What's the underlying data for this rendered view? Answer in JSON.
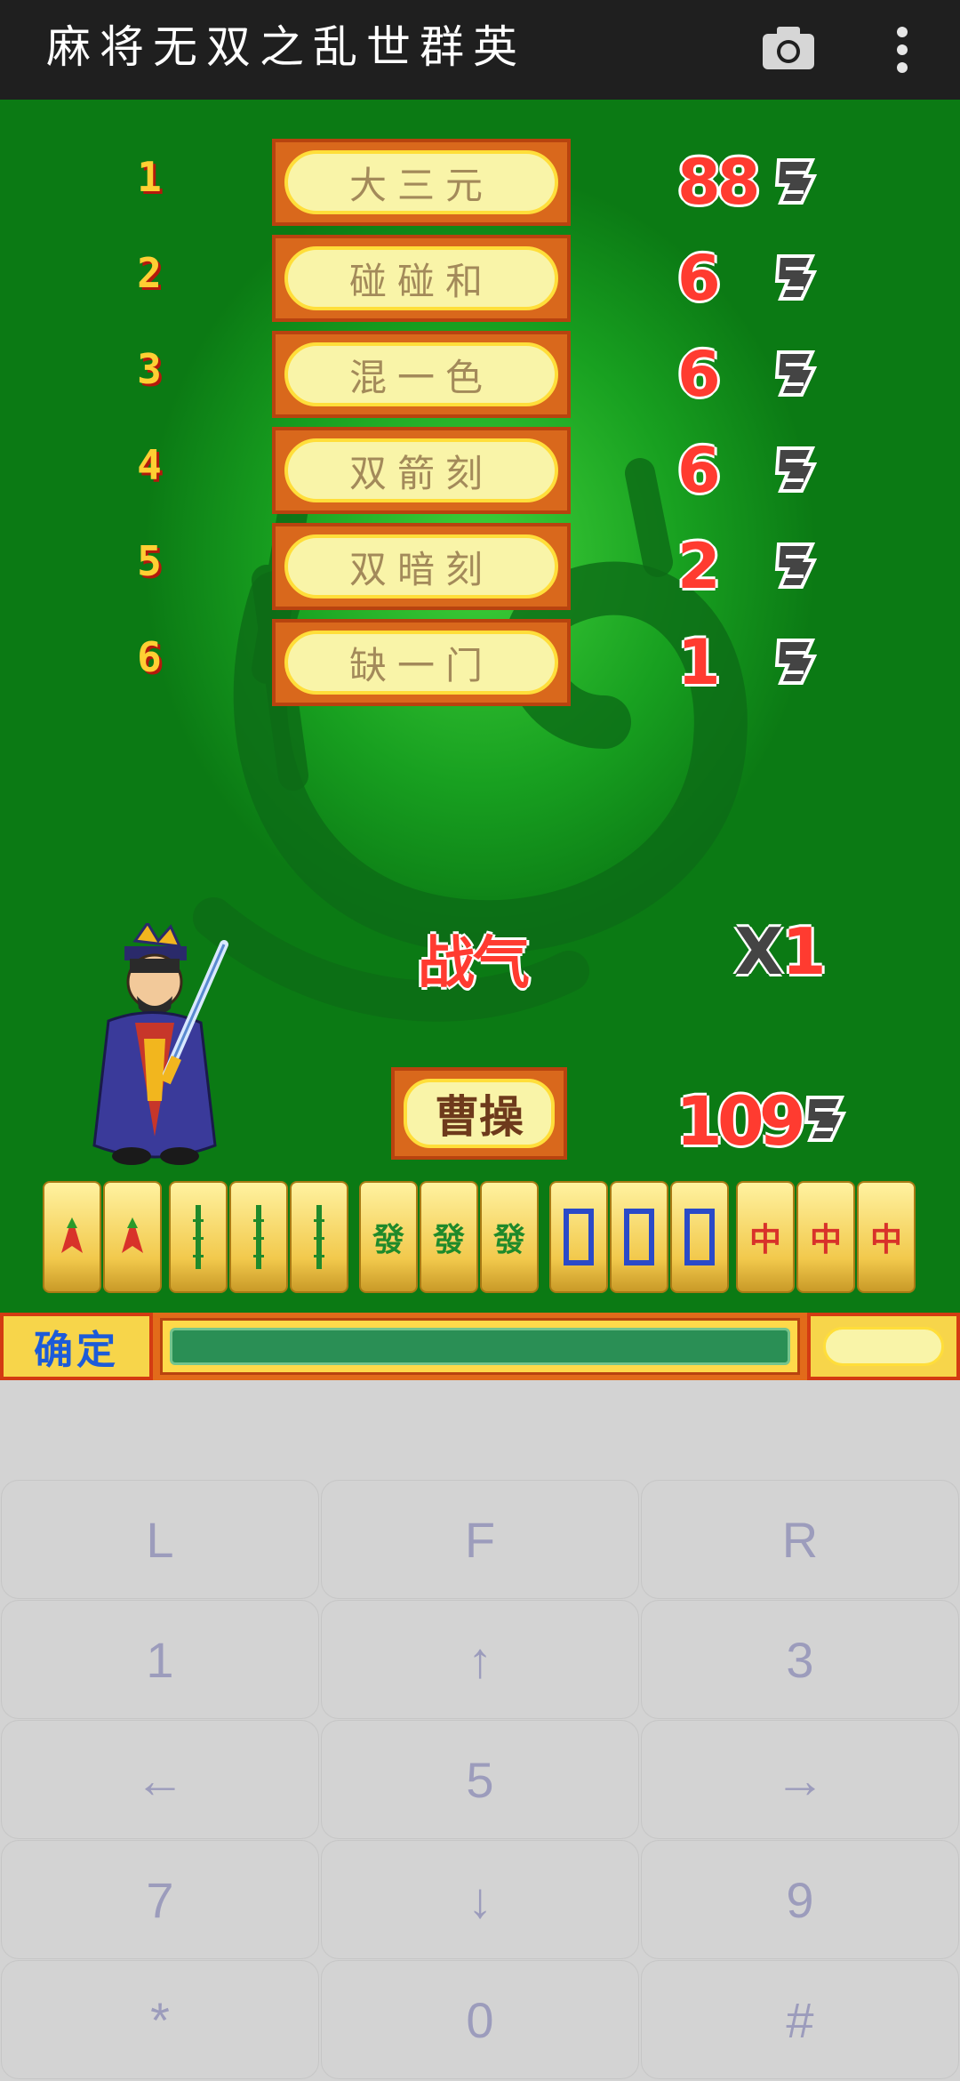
{
  "app": {
    "title": "麻将无双之乱世群英",
    "camera_icon": "camera-icon",
    "menu_icon": "more-vertical-icon"
  },
  "game": {
    "yaku": [
      {
        "num": "1",
        "name": "大三元",
        "points": "88"
      },
      {
        "num": "2",
        "name": "碰碰和",
        "points": "6"
      },
      {
        "num": "3",
        "name": "混一色",
        "points": "6"
      },
      {
        "num": "4",
        "name": "双箭刻",
        "points": "6"
      },
      {
        "num": "5",
        "name": "双暗刻",
        "points": "2"
      },
      {
        "num": "6",
        "name": "缺一门",
        "points": "1"
      }
    ],
    "fan_unit_icon": "fan-unit-icon",
    "morale_label": "战气",
    "multiplier_x": "X",
    "multiplier_value": "1",
    "player_name": "曹操",
    "total_points": "109",
    "tiles": [
      "发",
      "发",
      "条",
      "条",
      "条",
      "發",
      "發",
      "發",
      "□",
      "□",
      "□",
      "中",
      "中",
      "中"
    ],
    "confirm_label": "确定",
    "colors": {
      "background_green": "#0b7a14",
      "points_red": "#ff3b30",
      "plaque_orange": "#d9681c",
      "plaque_cream": "#f9f4a8"
    }
  },
  "keypad": {
    "keys": [
      "L",
      "F",
      "R",
      "1",
      "↑",
      "3",
      "←",
      "5",
      "→",
      "7",
      "↓",
      "9",
      "*",
      "0",
      "#"
    ]
  }
}
